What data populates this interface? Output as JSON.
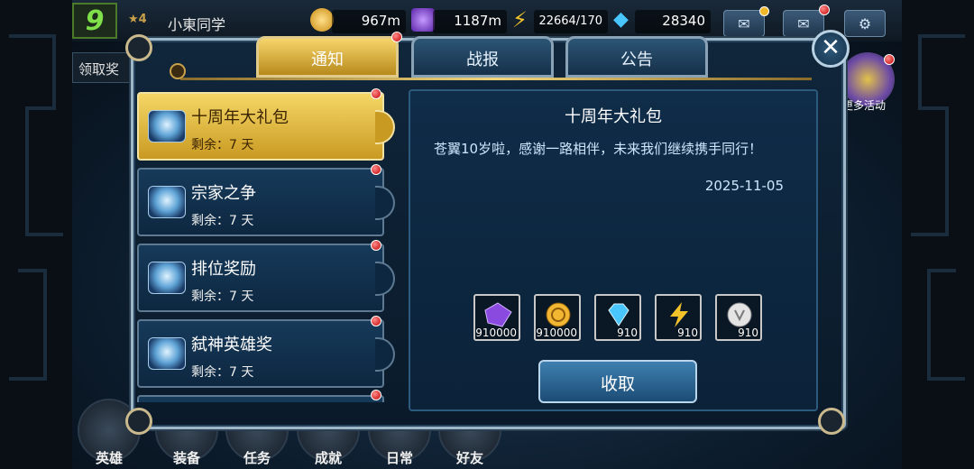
{
  "player": {
    "level": "9",
    "name": "小東同学",
    "rank": "4"
  },
  "resources": [
    {
      "name": "gold",
      "value": "967m",
      "color": "#f2b632"
    },
    {
      "name": "crystal",
      "value": "1187m",
      "color": "#8a4ae0"
    },
    {
      "name": "stamina",
      "value": "22664/170",
      "color": "#f2c22a"
    },
    {
      "name": "diamond",
      "value": "28340",
      "color": "#4ac6ff"
    }
  ],
  "side_tag": "领取奖",
  "more_activities": "更多活动",
  "tabs": [
    {
      "label": "通知",
      "active": true
    },
    {
      "label": "战报",
      "active": false
    },
    {
      "label": "公告",
      "active": false
    }
  ],
  "mail_items": [
    {
      "title": "十周年大礼包",
      "remaining": "剩余：7 天",
      "active": true
    },
    {
      "title": "宗家之争",
      "remaining": "剩余：7 天",
      "active": false
    },
    {
      "title": "排位奖励",
      "remaining": "剩余：7 天",
      "active": false
    },
    {
      "title": "弑神英雄奖",
      "remaining": "剩余：7 天",
      "active": false
    }
  ],
  "detail": {
    "title": "十周年大礼包",
    "body": "苍翼10岁啦，感谢一路相伴，未来我们继续携手同行！",
    "date": "2025-11-05",
    "rewards": [
      {
        "icon": "crystal-icon",
        "qty": "910000",
        "color": "#8a4ae0"
      },
      {
        "icon": "gold-coin-icon",
        "qty": "910000",
        "color": "#f2b632"
      },
      {
        "icon": "diamond-icon",
        "qty": "910",
        "color": "#4ac6ff"
      },
      {
        "icon": "lightning-icon",
        "qty": "910",
        "color": "#f2c22a"
      },
      {
        "icon": "silver-token-icon",
        "qty": "910",
        "color": "#d8d8d8"
      }
    ],
    "claim_label": "收取"
  },
  "bottom_nav": [
    "英雄",
    "装备",
    "任务",
    "成就",
    "日常",
    "好友"
  ]
}
